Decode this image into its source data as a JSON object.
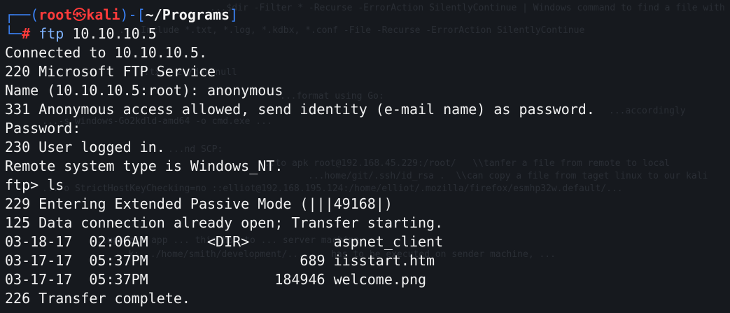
{
  "background_ghost": [
    "...$dir -Filter * -Recurse -ErrorAction SilentlyContinue | Windows command to find a file with its extentions:",
    "...-Include *.txt, *.log, *.kdbx, *.conf -File -Recurse -ErrorAction SilentlyContinue",
    "...txt\" 2>/dev/null",
    "...format using Go:",
    "...accordingly",
    "...-s windows-Go2kdld-amd64 -o cmd.exe ...",
    "...nd SCP:",
    "...to apk root@192.168.45.229:/root/   \\\\tanfer a file from remote to local",
    "...home/git/.ssh/id_rsa .  \\\\can copy a file from taget linux to our kali",
    "...-o StrictHostKeyChecking=no ::elliot@192.168.195.124:/home/elliot/.mozilla/firefox/esmhp32w.default/...",
    "...upgrade app ... this has to ... server machine",
    "...k:.../home/smith/development/... ... has to be executed on sender machine, ..."
  ],
  "prompt": {
    "corner_top": "┌──(",
    "user": "root",
    "skull": "㉿",
    "host": "kali",
    "sep": ")-[",
    "path": "~/Programs",
    "close": "]",
    "corner_bottom": "└─",
    "hash": "#",
    "command_name": "ftp",
    "command_args": " 10.10.10.5"
  },
  "output_lines": [
    "Connected to 10.10.10.5.",
    "220 Microsoft FTP Service",
    "Name (10.10.10.5:root): anonymous",
    "331 Anonymous access allowed, send identity (e-mail name) as password.",
    "Password:",
    "230 User logged in.",
    "Remote system type is Windows_NT.",
    "ftp> ls",
    "229 Entering Extended Passive Mode (|||49168|)",
    "125 Data connection already open; Transfer starting.",
    "03-18-17  02:06AM       <DIR>          aspnet_client",
    "03-17-17  05:37PM                  689 iisstart.htm",
    "03-17-17  05:37PM               184946 welcome.png",
    "226 Transfer complete."
  ],
  "colors": {
    "background": "#16191e",
    "text": "#f2f2f2",
    "prompt_blue": "#3b82f6",
    "prompt_red": "#ff3b3b",
    "command_blue": "#7fb3ff"
  }
}
